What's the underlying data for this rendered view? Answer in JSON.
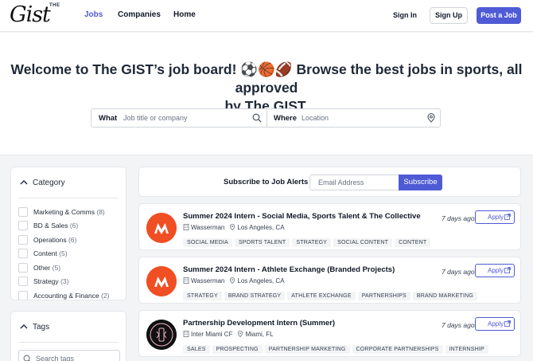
{
  "header": {
    "logo_small": "THE",
    "logo_main": "Gist",
    "nav": [
      {
        "label": "Jobs",
        "active": true
      },
      {
        "label": "Companies",
        "active": false
      },
      {
        "label": "Home",
        "active": false
      }
    ],
    "sign_in": "Sign In",
    "sign_up": "Sign Up",
    "post_job": "Post a Job"
  },
  "hero": {
    "title_line1": "Welcome to The GIST’s job board! ⚽🏀🏈 Browse the best jobs in sports, all approved",
    "title_line2": "by The GIST.",
    "what_label": "What",
    "what_placeholder": "Job title or company",
    "where_label": "Where",
    "where_placeholder": "Location",
    "search_icon": "search-icon",
    "location_icon": "map-pin-icon"
  },
  "category": {
    "title": "Category",
    "items": [
      {
        "label": "Marketing & Comms",
        "count": "(8)"
      },
      {
        "label": "BD & Sales",
        "count": "(6)"
      },
      {
        "label": "Operations",
        "count": "(6)"
      },
      {
        "label": "Content",
        "count": "(5)"
      },
      {
        "label": "Other",
        "count": "(5)"
      },
      {
        "label": "Strategy",
        "count": "(3)"
      },
      {
        "label": "Accounting & Finance",
        "count": "(2)"
      }
    ]
  },
  "tags": {
    "title": "Tags",
    "placeholder": "Search tags"
  },
  "alerts": {
    "label": "Subscribe to Job Alerts",
    "email_placeholder": "Email Address",
    "button": "Subscribe"
  },
  "jobs": [
    {
      "title": "Summer 2024 Intern - Social Media, Sports Talent & The Collective",
      "company": "Wasserman",
      "location": "Los Angeles, CA",
      "date": "7 days ago",
      "apply": "Apply",
      "tags": [
        "SOCIAL MEDIA",
        "SPORTS TALENT",
        "STRATEGY",
        "SOCIAL CONTENT",
        "CONTENT"
      ],
      "logo_color": "#f04e23"
    },
    {
      "title": "Summer 2024 Intern - Athlete Exchange (Branded Projects)",
      "company": "Wasserman",
      "location": "Los Angeles, CA",
      "date": "7 days ago",
      "apply": "Apply",
      "tags": [
        "STRATEGY",
        "BRAND STRATEGY",
        "ATHLETE EXCHANGE",
        "PARTNERSHIPS",
        "BRAND MARKETING"
      ],
      "logo_color": "#f04e23"
    },
    {
      "title": "Partnership Development Intern (Summer)",
      "company": "Inter Miami CF",
      "location": "Miami, FL",
      "date": "7 days ago",
      "apply": "Apply",
      "tags": [
        "SALES",
        "PROSPECTING",
        "PARTNERSHIP MARKETING",
        "CORPORATE PARTNERSHIPS",
        "INTERNSHIP"
      ],
      "logo_color": "#111111"
    }
  ],
  "colors": {
    "accent": "#4f5bd5",
    "wasserman": "#f04e23",
    "background": "#f3f4f6"
  }
}
